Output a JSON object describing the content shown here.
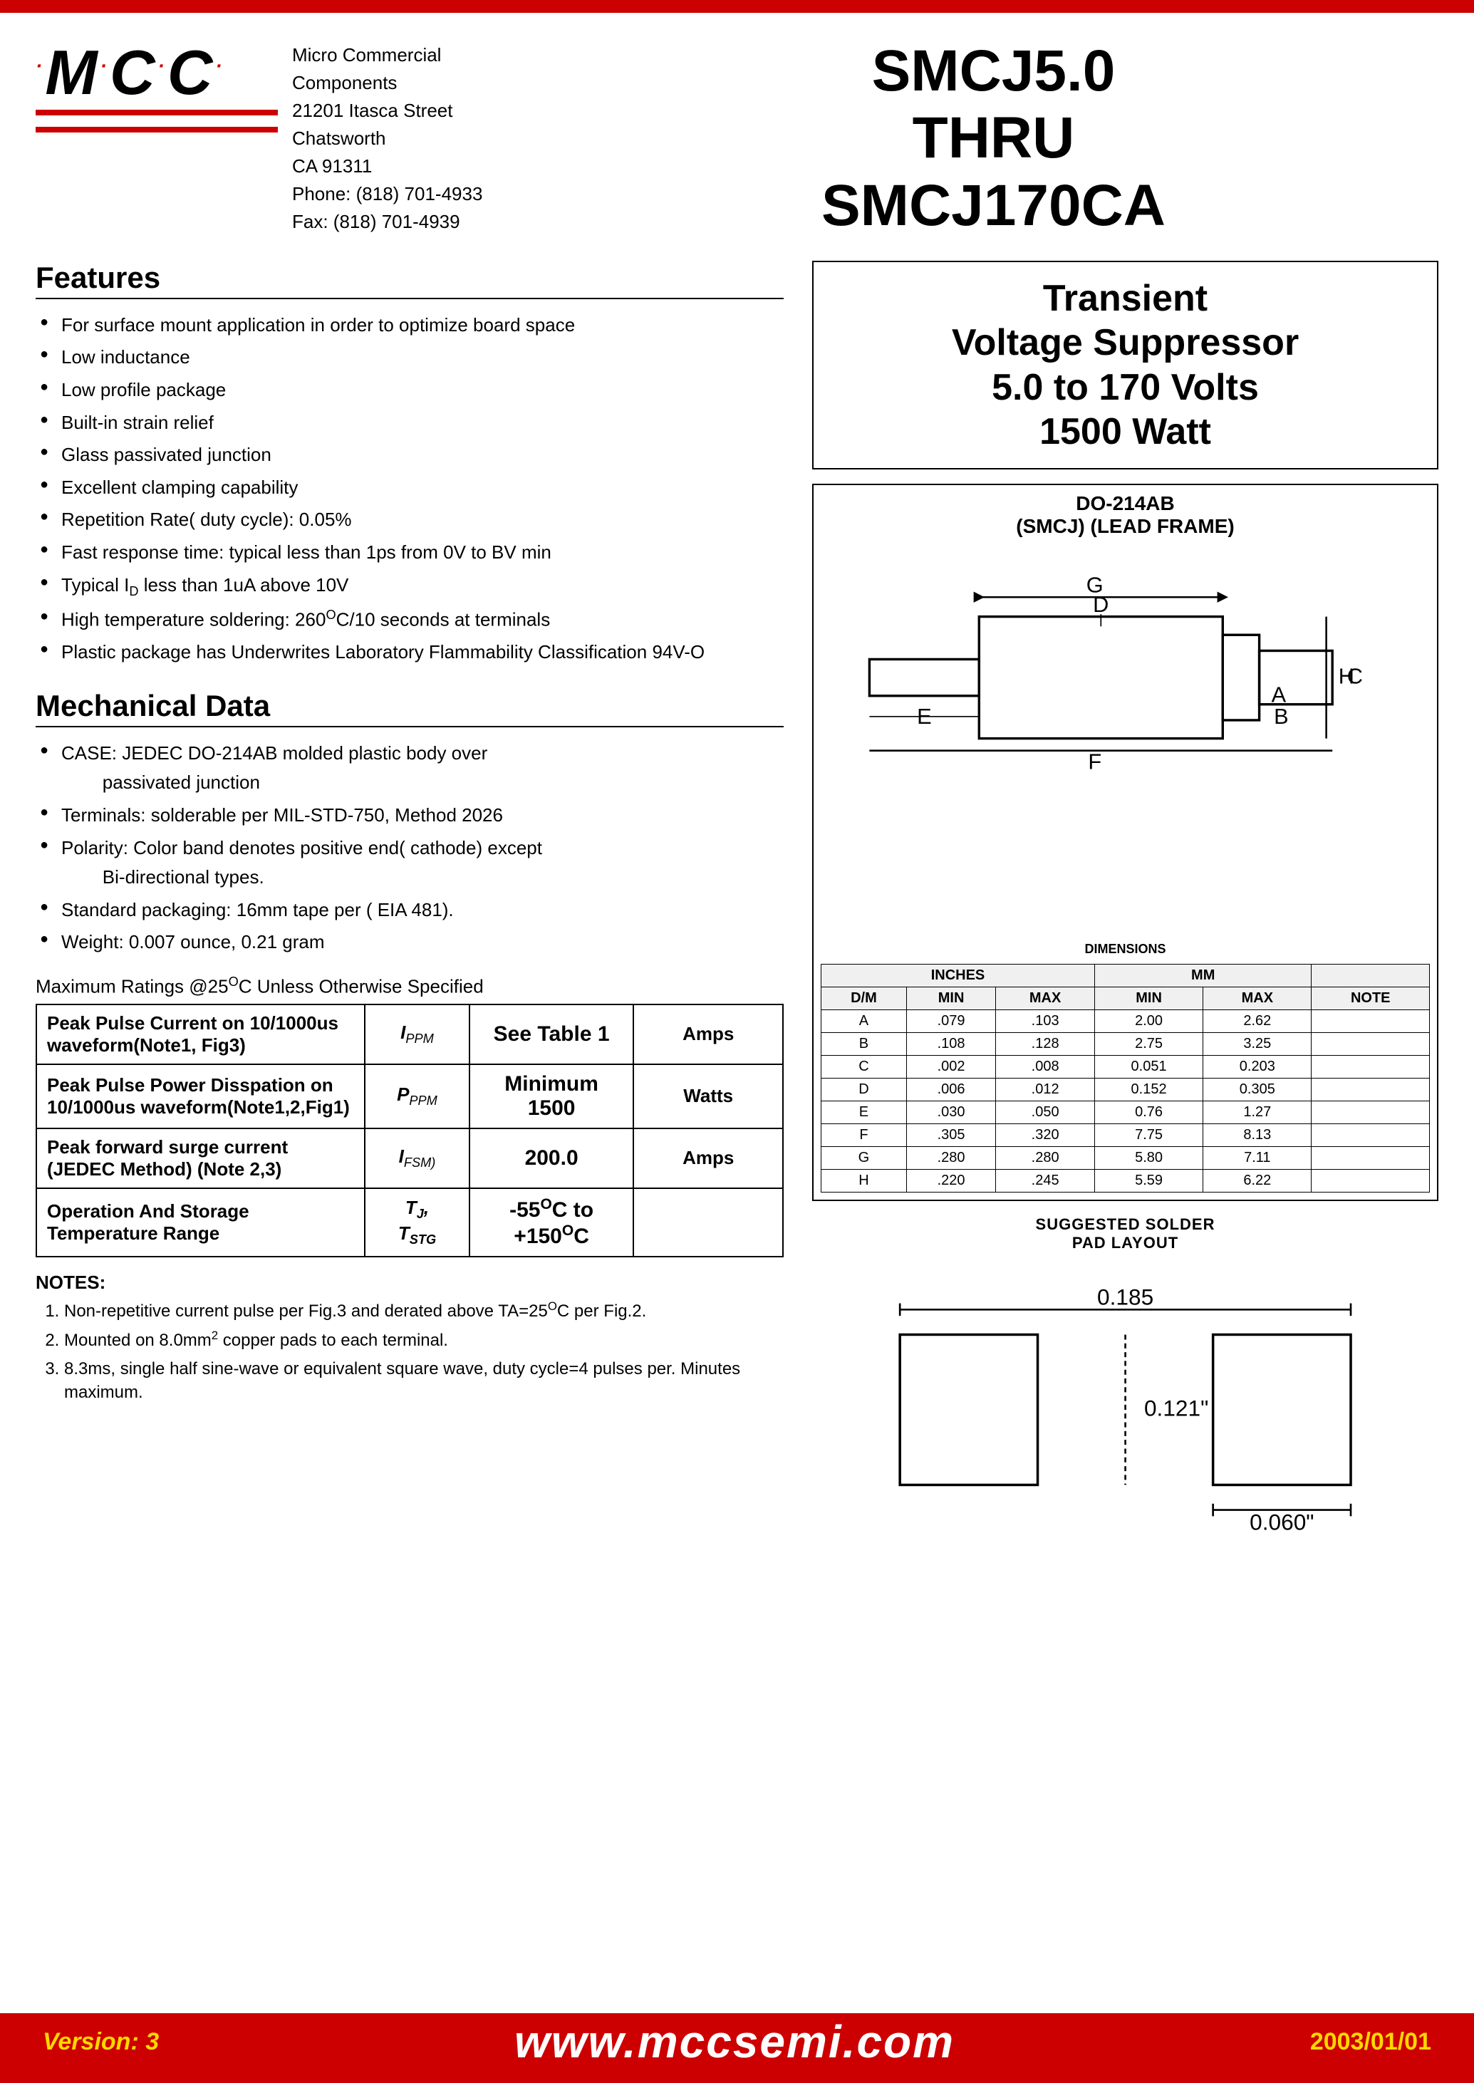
{
  "top_bar": {},
  "header": {
    "logo_dots": "·M·C·C·",
    "company_name": "Micro Commercial Components",
    "company_address1": "21201 Itasca Street Chatsworth",
    "company_address2": "CA 91311",
    "company_phone": "Phone: (818) 701-4933",
    "company_fax": "Fax:    (818) 701-4939",
    "part_number": "SMCJ5.0\nTHRU\nSMCJ170CA"
  },
  "features": {
    "title": "Features",
    "items": [
      "For surface mount application in order to optimize board space",
      "Low inductance",
      "Low profile package",
      "Built-in strain relief",
      "Glass passivated junction",
      "Excellent clamping capability",
      "Repetition Rate( duty cycle): 0.05%",
      "Fast response time: typical less than 1ps from 0V to BV min",
      "Typical I₀ less than 1uA above 10V",
      "High temperature soldering: 260°C/10 seconds at terminals",
      "Plastic package has Underwrites Laboratory Flammability Classification 94V-O"
    ]
  },
  "mechanical": {
    "title": "Mechanical Data",
    "items": [
      "CASE: JEDEC DO-214AB molded plastic body over passivated junction",
      "Terminals:  solderable per MIL-STD-750, Method 2026",
      "Polarity: Color band denotes positive end( cathode) except Bi-directional types.",
      "Standard packaging: 16mm tape per ( EIA 481).",
      "Weight: 0.007 ounce, 0.21 gram"
    ]
  },
  "max_ratings": {
    "title": "Maximum Ratings @25°C Unless Otherwise Specified",
    "rows": [
      {
        "label": "Peak Pulse Current on 10/1000us waveform(Note1, Fig3)",
        "symbol": "IPPM",
        "value": "See Table 1",
        "unit": "Amps"
      },
      {
        "label": "Peak Pulse Power Disspation on 10/1000us waveform(Note1,2,Fig1)",
        "symbol": "PPPM",
        "value": "Minimum\n1500",
        "unit": "Watts"
      },
      {
        "label": "Peak forward surge current (JEDEC Method) (Note 2,3)",
        "symbol": "IFSM)",
        "value": "200.0",
        "unit": "Amps"
      },
      {
        "label": "Operation And Storage Temperature Range",
        "symbol": "TJ,\nTSTG",
        "value": "-55°C to\n+150°C",
        "unit": ""
      }
    ]
  },
  "device_package": {
    "title": "DO-214AB\n(SMCJ) (LEAD FRAME)"
  },
  "tvs": {
    "title": "Transient\nVoltage Suppressor\n5.0 to 170 Volts\n1500 Watt"
  },
  "dimensions": {
    "header_dim": "DIMENSIONS",
    "col_inches": "INCHES",
    "col_mm": "MM",
    "cols": [
      "D/M",
      "MIN",
      "MAX",
      "MIN",
      "MAX",
      "NOTE"
    ],
    "rows": [
      [
        "A",
        ".079",
        ".103",
        "2.00",
        "2.62",
        ""
      ],
      [
        "B",
        ".108",
        ".128",
        "2.75",
        "3.25",
        ""
      ],
      [
        "C",
        ".002",
        ".008",
        "0.051",
        "0.203",
        ""
      ],
      [
        "D",
        ".006",
        ".012",
        "0.152",
        "0.305",
        ""
      ],
      [
        "E",
        ".030",
        ".050",
        "0.76",
        "1.27",
        ""
      ],
      [
        "F",
        ".305",
        ".320",
        "7.75",
        "8.13",
        ""
      ],
      [
        "G",
        ".280",
        ".280",
        "5.80",
        "7.11",
        ""
      ],
      [
        "H",
        ".220",
        ".245",
        "5.59",
        "6.22",
        ""
      ]
    ]
  },
  "solder_pad": {
    "title": "SUGGESTED SOLDER\nPAD LAYOUT",
    "dim1": "0.185",
    "dim2": "0.121\"",
    "dim3": "0.060\""
  },
  "notes": {
    "title": "NOTES:",
    "items": [
      "Non-repetitive current pulse per Fig.3 and derated above TA=25°C per Fig.2.",
      "Mounted on 8.0mm² copper pads to each terminal.",
      "8.3ms, single half sine-wave or equivalent square wave, duty cycle=4 pulses per. Minutes maximum."
    ]
  },
  "footer": {
    "version_label": "Version: 3",
    "website": "www.mccsemi.com",
    "date": "2003/01/01"
  }
}
